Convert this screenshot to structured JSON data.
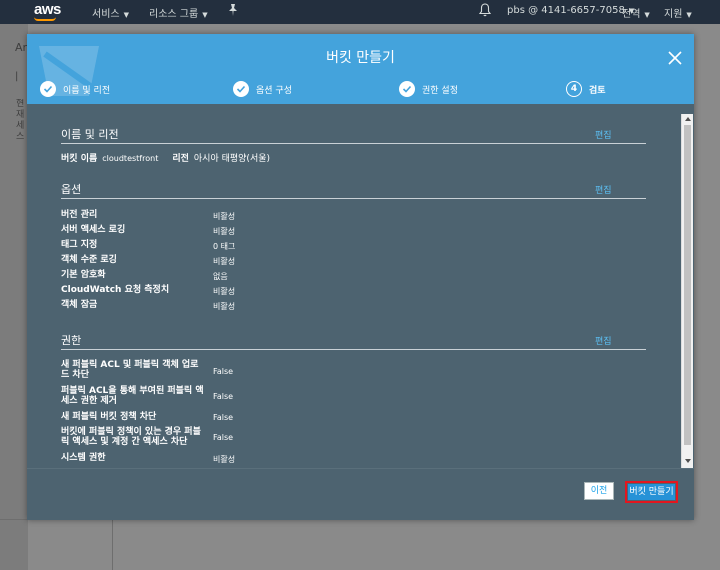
{
  "topnav": {
    "logo": "aws",
    "services": "서비스",
    "resource_groups": "리소스 그룹",
    "account": "pbs @ 4141-6657-7058",
    "region": "전역",
    "support": "지원"
  },
  "background": {
    "fragment1": "An",
    "fragment2": "|",
    "fragment3": "현재 세스"
  },
  "modal": {
    "title": "버킷 만들기",
    "steps": [
      {
        "label": "이름 및 리전",
        "state": "done"
      },
      {
        "label": "옵션 구성",
        "state": "done"
      },
      {
        "label": "권한 설정",
        "state": "done"
      },
      {
        "label": "검토",
        "number": "4",
        "state": "current"
      }
    ],
    "sections": {
      "name_region": {
        "title": "이름 및 리전",
        "edit": "편집",
        "bucket_name_label": "버킷 이름",
        "bucket_name_value": "cloudtestfront",
        "region_label": "리전",
        "region_value": "아시아 태평양(서울)"
      },
      "options": {
        "title": "옵션",
        "edit": "편집",
        "rows": [
          {
            "label": "버전 관리",
            "value": "비활성"
          },
          {
            "label": "서버 액세스 로깅",
            "value": "비활성"
          },
          {
            "label": "태그 지정",
            "value": "0 태그"
          },
          {
            "label": "객체 수준 로깅",
            "value": "비활성"
          },
          {
            "label": "기본 암호화",
            "value": "없음"
          },
          {
            "label": "CloudWatch 요청 측정치",
            "value": "비활성"
          },
          {
            "label": "객체 잠금",
            "value": "비활성"
          }
        ]
      },
      "permissions": {
        "title": "권한",
        "edit": "편집",
        "rows": [
          {
            "label_line1": "새 퍼블릭 ACL 및 퍼블릭 객체 업로",
            "label_line2": "드 차단",
            "value": "False"
          },
          {
            "label_line1": "퍼블릭 ACL을 통해 부여된 퍼블릭 액",
            "label_line2": "세스 권한 제거",
            "value": "False"
          },
          {
            "label_line1": "새 퍼블릭 버킷 정책 차단",
            "label_line2": "",
            "value": "False"
          },
          {
            "label_line1": "버킷에 퍼블릭 정책이 있는 경우 퍼블",
            "label_line2": "릭 액세스 및 계정 간 액세스 차단",
            "value": "False"
          },
          {
            "label_line1": "시스템 권한",
            "label_line2": "",
            "value": "비활성"
          }
        ]
      }
    },
    "footer": {
      "prev": "이전",
      "create": "버킷 만들기"
    }
  },
  "colors": {
    "header_blue": "#44a3dc",
    "modal_body": "#4d6370",
    "edit_link": "#5cc0f5",
    "primary_button": "#2692d7",
    "highlight_box": "#e3161f"
  }
}
